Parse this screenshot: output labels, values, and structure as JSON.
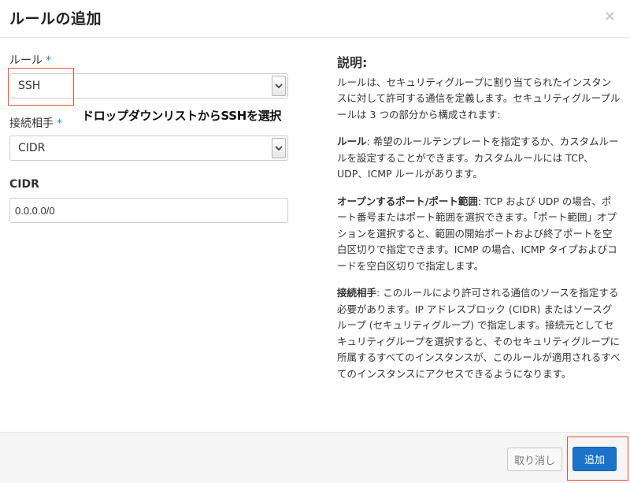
{
  "dialog": {
    "title": "ルールの追加",
    "close_symbol": "×"
  },
  "form": {
    "rule_label": "ルール",
    "required_mark": "*",
    "rule_value": "SSH",
    "remote_label": "接続相手",
    "remote_value": "CIDR",
    "cidr_label": "CIDR",
    "cidr_value": "0.0.0.0/0"
  },
  "annotation": {
    "text": "ドロップダウンリストからSSHを選択",
    "color": "#e2553a"
  },
  "help": {
    "title": "説明:",
    "intro": "ルールは、セキュリティグループに割り当てられたインスタンスに対して許可する通信を定義します。セキュリティグループルールは 3 つの部分から構成されます:",
    "rule_term": "ルール",
    "rule_desc": ": 希望のルールテンプレートを指定するか、カスタムルールを設定することができます。カスタムルールには TCP、UDP、ICMP ルールがあります。",
    "port_term": "オープンするポート/ポート範囲",
    "port_desc": ": TCP および UDP の場合、ポート番号またはポート範囲を選択できます。「ポート範囲」オプションを選択すると、範囲の開始ポートおよび終了ポートを空白区切りで指定できます。ICMP の場合、ICMP タイプおよびコードを空白区切りで指定します。",
    "remote_term": "接続相手",
    "remote_desc": ": このルールにより許可される通信のソースを指定する必要があります。IP アドレスブロック (CIDR) またはソースグループ (セキュリティグループ) で指定します。接続元としてセキュリティグループを選択すると、そのセキュリティグループに所属するすべてのインスタンスが、このルールが適用されるすべてのインスタンスにアクセスできるようになります。"
  },
  "footer": {
    "cancel_label": "取り消し",
    "add_label": "追加",
    "add_color": "#1a73c9"
  }
}
